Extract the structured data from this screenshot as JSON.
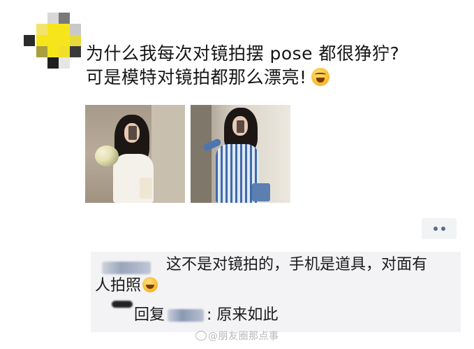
{
  "post": {
    "line1": "为什么我每次对镜拍摆 pose 都很狰狞?",
    "line2": "可是模特对镜拍都那么漂亮!",
    "emoji": "laughing-crying-emoji"
  },
  "photos": [
    {
      "name": "girl-white-dress-mirror-selfie"
    },
    {
      "name": "girl-blue-striped-dress-mirror-selfie"
    }
  ],
  "comments": {
    "first": {
      "line1": "这不是对镜拍的，手机是道具，对面有",
      "line2": "人拍照",
      "emoji": "laughing-emoji"
    },
    "second": {
      "prefix": "回复",
      "text": ": 原来如此"
    }
  },
  "watermark": "@朋友圈那点事",
  "colors": {
    "avatar_yellow": "#f7e51b",
    "comment_bg": "#f3f3f5",
    "dots": "#5a6b8c"
  }
}
